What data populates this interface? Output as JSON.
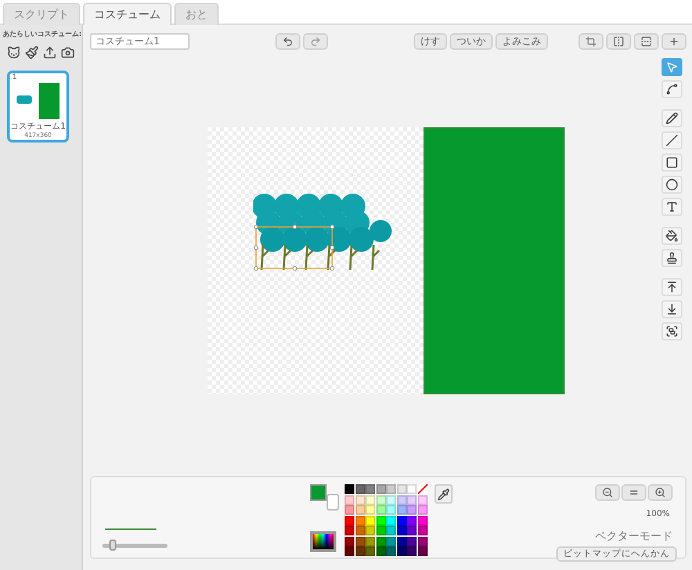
{
  "tabs": [
    {
      "label": "スクリプト",
      "selected": false
    },
    {
      "label": "コスチューム",
      "selected": true
    },
    {
      "label": "おと",
      "selected": false
    }
  ],
  "new_costume": {
    "label": "あたらしいコスチューム:"
  },
  "costumes": [
    {
      "number": "1",
      "name": "コスチューム1",
      "size": "417x360",
      "selected": true
    }
  ],
  "costume_name": {
    "value": "コスチューム1"
  },
  "edit_buttons": [
    "けす",
    "ついか",
    "よみこみ"
  ],
  "tools": [
    {
      "kind": "select",
      "selected": true
    },
    {
      "kind": "reshape",
      "selected": false
    },
    {
      "kind": "pencil",
      "selected": false
    },
    {
      "kind": "line",
      "selected": false
    },
    {
      "kind": "rect",
      "selected": false
    },
    {
      "kind": "ellipse",
      "selected": false
    },
    {
      "kind": "text",
      "selected": false
    },
    {
      "kind": "fill",
      "selected": false
    },
    {
      "kind": "stamp",
      "selected": false
    },
    {
      "kind": "front",
      "selected": false
    },
    {
      "kind": "back",
      "selected": false
    },
    {
      "kind": "group",
      "selected": false
    }
  ],
  "stroke": {
    "level": 0.12
  },
  "primary_color": {
    "color": "#079a2f"
  },
  "secondary_color": {
    "color": "#ffffff"
  },
  "palette": [
    {
      "kind": "swatch",
      "color": "#000000"
    },
    {
      "kind": "swatch",
      "color": "#666666"
    },
    {
      "kind": "swatch",
      "color": "#808080"
    },
    {
      "kind": "swatch",
      "color": "#a6a6a6"
    },
    {
      "kind": "swatch",
      "color": "#cccccc"
    },
    {
      "kind": "swatch",
      "color": "#e6e6e6"
    },
    {
      "kind": "swatch",
      "color": "#ffffff"
    },
    {
      "kind": "none"
    },
    {
      "kind": "swatch",
      "color": "#ffcccc"
    },
    {
      "kind": "swatch",
      "color": "#ffe5cc"
    },
    {
      "kind": "swatch",
      "color": "#ffffcc"
    },
    {
      "kind": "swatch",
      "color": "#ccffcc"
    },
    {
      "kind": "swatch",
      "color": "#ccffff"
    },
    {
      "kind": "swatch",
      "color": "#ccccff"
    },
    {
      "kind": "swatch",
      "color": "#e5ccff"
    },
    {
      "kind": "swatch",
      "color": "#ffccff"
    },
    {
      "kind": "swatch",
      "color": "#ff9999"
    },
    {
      "kind": "swatch",
      "color": "#ffcc99"
    },
    {
      "kind": "swatch",
      "color": "#ffff99"
    },
    {
      "kind": "swatch",
      "color": "#99ff99"
    },
    {
      "kind": "swatch",
      "color": "#99ffff"
    },
    {
      "kind": "swatch",
      "color": "#99b3ff"
    },
    {
      "kind": "swatch",
      "color": "#cc99ff"
    },
    {
      "kind": "swatch",
      "color": "#ff99ff"
    },
    {
      "kind": "swatch",
      "color": "#ff0000"
    },
    {
      "kind": "swatch",
      "color": "#ff8000"
    },
    {
      "kind": "swatch",
      "color": "#ffff00"
    },
    {
      "kind": "swatch",
      "color": "#00ff00"
    },
    {
      "kind": "swatch",
      "color": "#00ffff"
    },
    {
      "kind": "swatch",
      "color": "#0000ff"
    },
    {
      "kind": "swatch",
      "color": "#8000ff"
    },
    {
      "kind": "swatch",
      "color": "#ff00cc"
    },
    {
      "kind": "swatch",
      "color": "#cc0000"
    },
    {
      "kind": "swatch",
      "color": "#cc6600"
    },
    {
      "kind": "swatch",
      "color": "#cccc00"
    },
    {
      "kind": "swatch",
      "color": "#00cc00"
    },
    {
      "kind": "swatch",
      "color": "#00cccc"
    },
    {
      "kind": "swatch",
      "color": "#0000cc"
    },
    {
      "kind": "swatch",
      "color": "#6600cc"
    },
    {
      "kind": "swatch",
      "color": "#cc0099"
    },
    {
      "kind": "swatch",
      "color": "#990000"
    },
    {
      "kind": "swatch",
      "color": "#994c00"
    },
    {
      "kind": "swatch",
      "color": "#999900"
    },
    {
      "kind": "swatch",
      "color": "#009900"
    },
    {
      "kind": "swatch",
      "color": "#009999"
    },
    {
      "kind": "swatch",
      "color": "#000099"
    },
    {
      "kind": "swatch",
      "color": "#4c0099"
    },
    {
      "kind": "swatch",
      "color": "#990073"
    },
    {
      "kind": "swatch",
      "color": "#660000"
    },
    {
      "kind": "swatch",
      "color": "#663300"
    },
    {
      "kind": "swatch",
      "color": "#666600"
    },
    {
      "kind": "swatch",
      "color": "#006600"
    },
    {
      "kind": "swatch",
      "color": "#006666"
    },
    {
      "kind": "swatch",
      "color": "#000066"
    },
    {
      "kind": "swatch",
      "color": "#330066"
    },
    {
      "kind": "swatch",
      "color": "#66004c"
    }
  ],
  "zoom_level": "100%",
  "mode": "ベクターモード",
  "convert_button": "ビットマップにへんかん"
}
